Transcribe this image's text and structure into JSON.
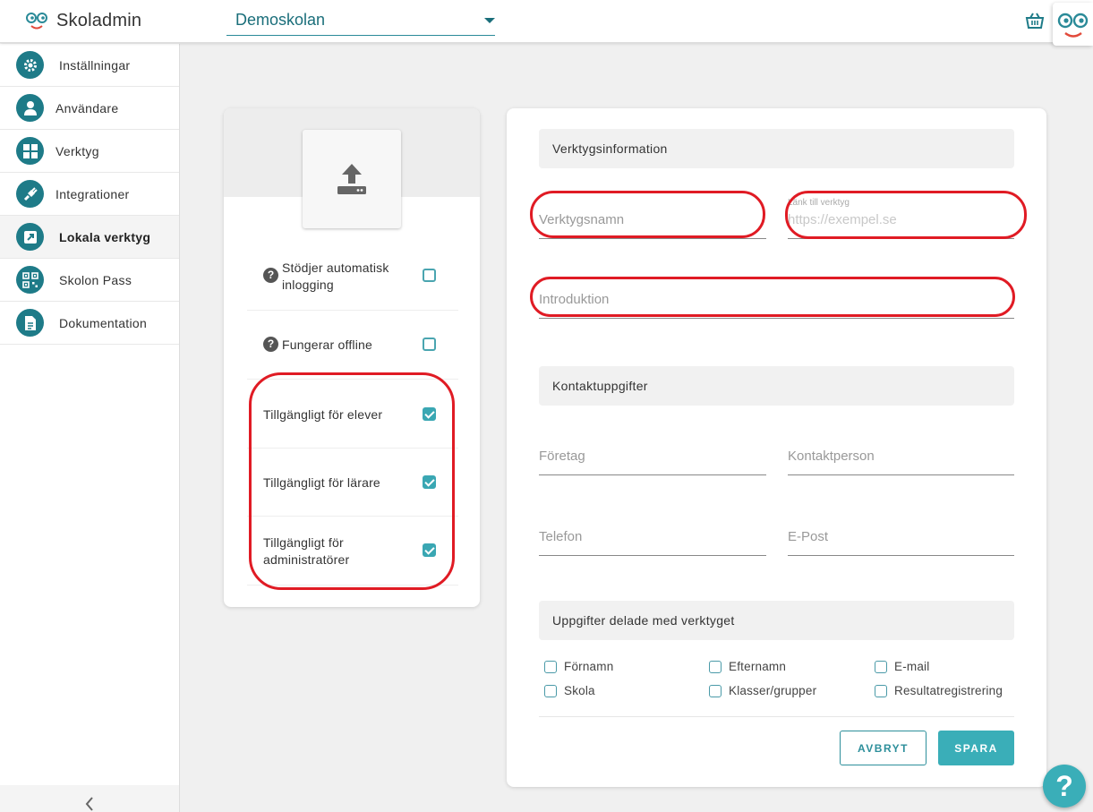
{
  "app": {
    "title": "Skoladmin"
  },
  "school_select": {
    "value": "Demoskolan"
  },
  "sidebar": {
    "items": [
      {
        "label": "Inställningar",
        "icon": "gear-icon"
      },
      {
        "label": "Användare",
        "icon": "user-icon"
      },
      {
        "label": "Verktyg",
        "icon": "grid-icon"
      },
      {
        "label": "Integrationer",
        "icon": "plug-icon"
      },
      {
        "label": "Lokala verktyg",
        "icon": "external-link-icon",
        "active": true
      },
      {
        "label": "Skolon Pass",
        "icon": "qr-code-icon"
      },
      {
        "label": "Dokumentation",
        "icon": "document-icon"
      }
    ]
  },
  "tool_options": {
    "auto_login": {
      "label": "Stödjer automatisk inlogging",
      "checked": false
    },
    "offline": {
      "label": "Fungerar offline",
      "checked": false
    },
    "students": {
      "label": "Tillgängligt för elever",
      "checked": true
    },
    "teachers": {
      "label": "Tillgängligt för lärare",
      "checked": true
    },
    "admins": {
      "label": "Tillgängligt för administratörer",
      "checked": true
    }
  },
  "tool_info": {
    "heading": "Verktygsinformation",
    "name_placeholder": "Verktygsnamn",
    "link_label": "Länk till verktyg",
    "link_placeholder": "https://exempel.se",
    "intro_placeholder": "Introduktion"
  },
  "contact": {
    "heading": "Kontaktuppgifter",
    "company_placeholder": "Företag",
    "person_placeholder": "Kontaktperson",
    "phone_placeholder": "Telefon",
    "email_placeholder": "E-Post"
  },
  "shared": {
    "heading": "Uppgifter delade med verktyget",
    "items": [
      "Förnamn",
      "Efternamn",
      "E-mail",
      "Skola",
      "Klasser/grupper",
      "Resultatregistrering"
    ]
  },
  "actions": {
    "cancel": "AVBRYT",
    "save": "SPARA"
  },
  "help": {
    "label": "?"
  },
  "colors": {
    "accent": "#1e7b88",
    "button": "#3aaeb8",
    "annotation": "#e01b24"
  }
}
